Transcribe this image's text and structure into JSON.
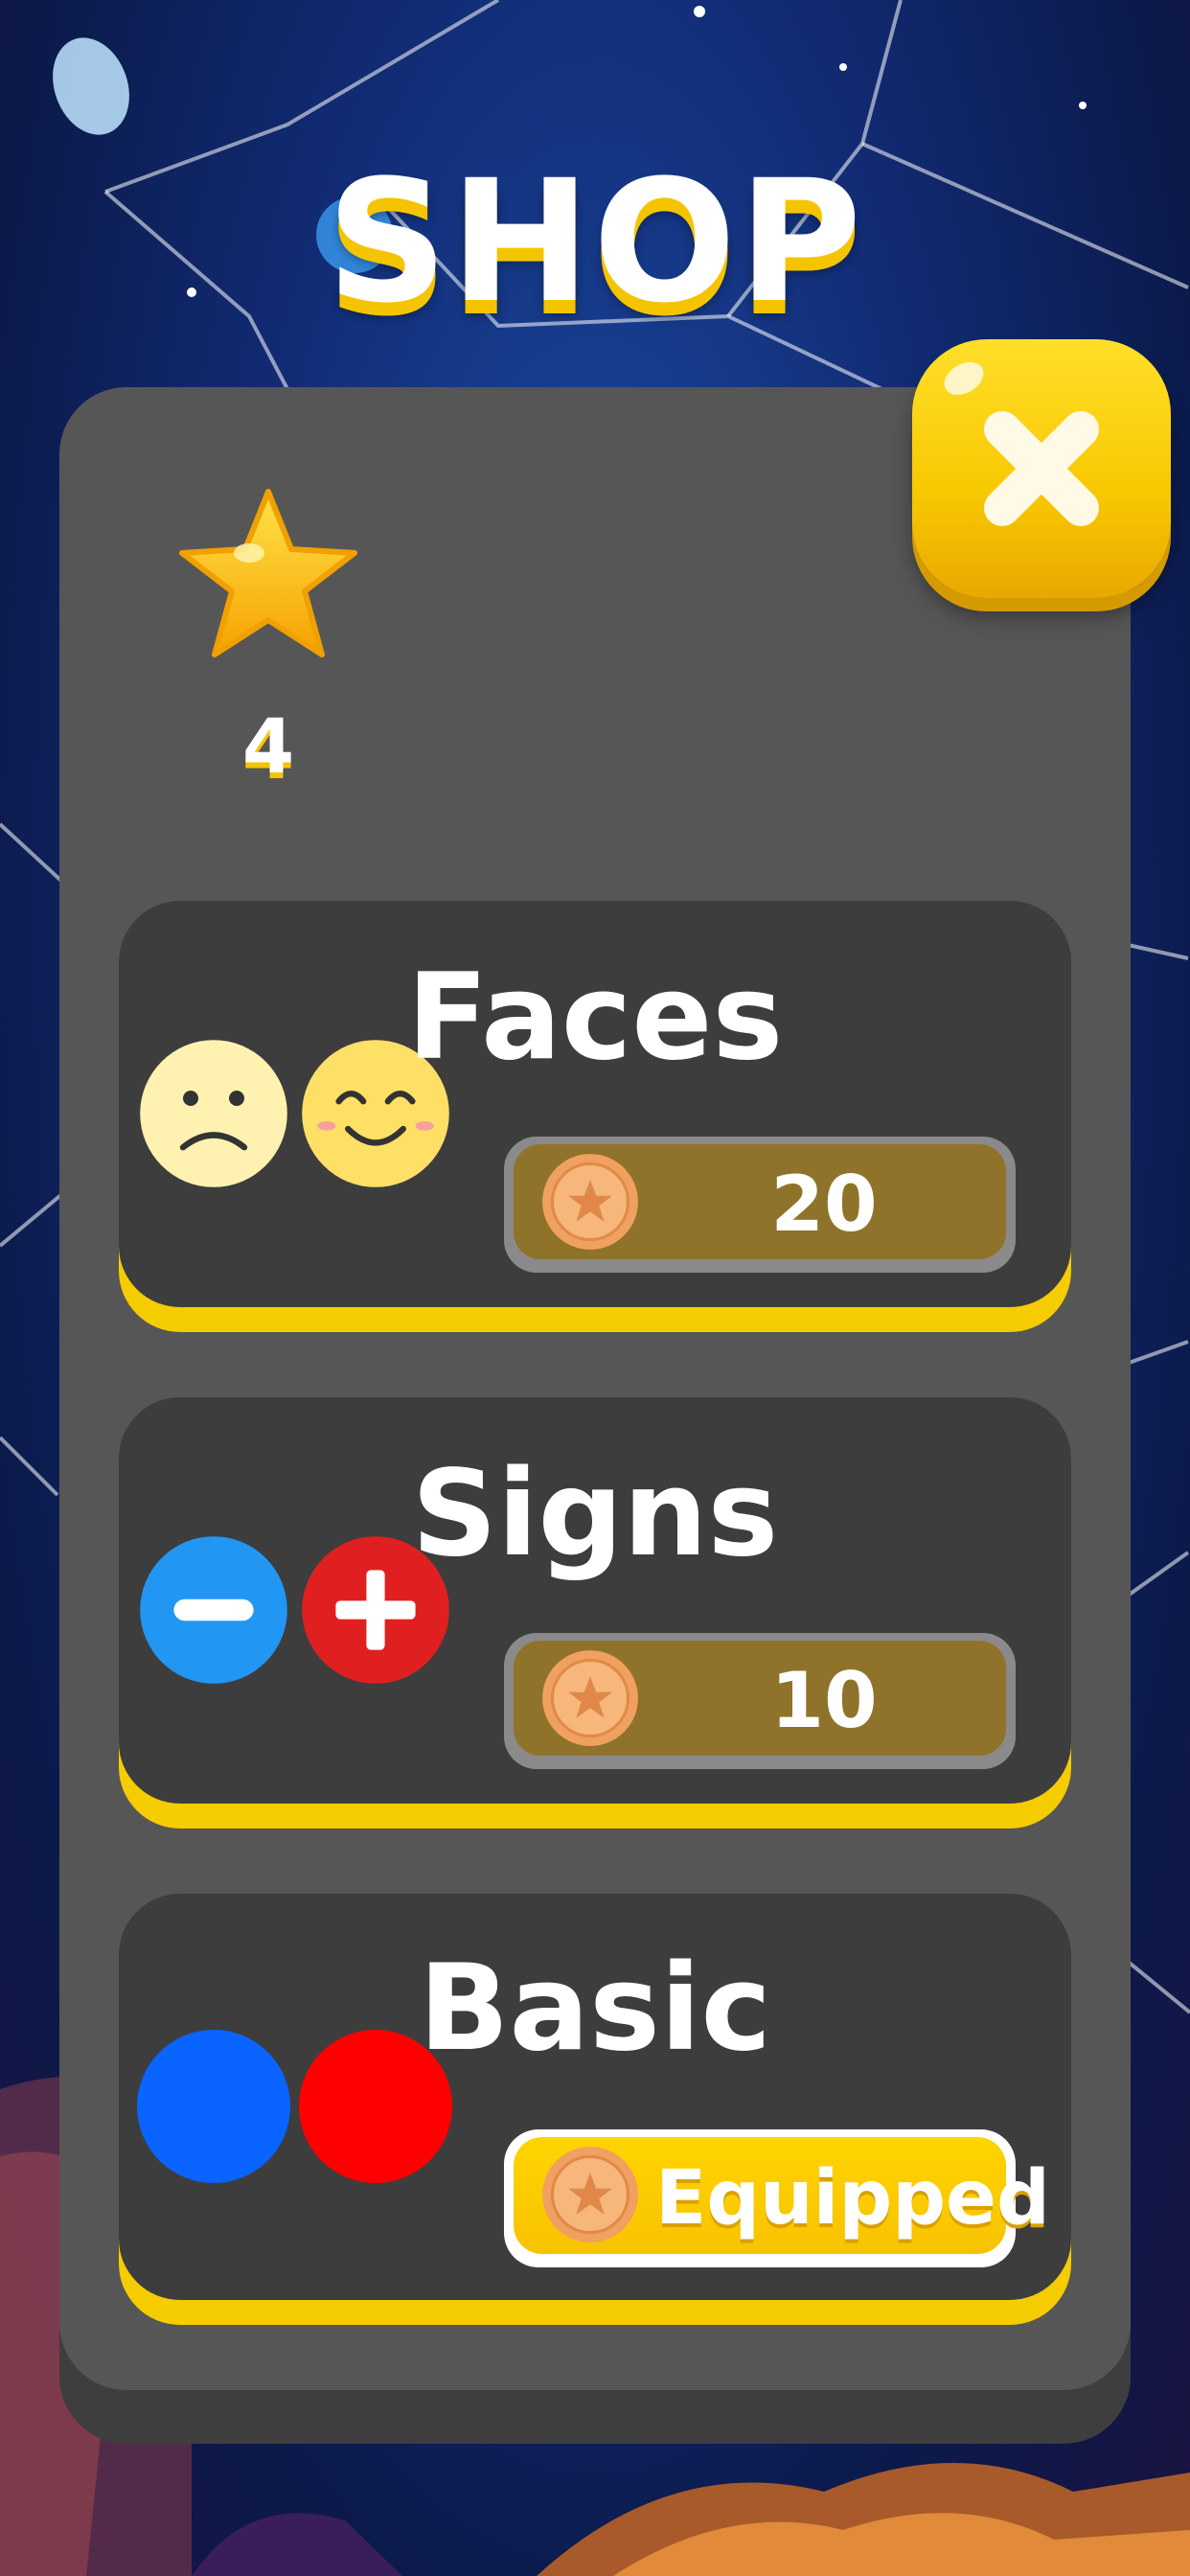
{
  "title": "SHOP",
  "stars": {
    "icon": "star-icon",
    "count": "4"
  },
  "close": {
    "icon": "close-icon"
  },
  "items": [
    {
      "name": "Faces",
      "icons": [
        "sad-face-icon",
        "smile-face-icon"
      ],
      "price": "20",
      "price_icon": "coin-icon"
    },
    {
      "name": "Signs",
      "icons": [
        "minus-circle-icon",
        "plus-circle-icon"
      ],
      "price": "10",
      "price_icon": "coin-icon"
    },
    {
      "name": "Basic",
      "icons": [
        "blue-circle-icon",
        "red-circle-icon"
      ],
      "status": "Equipped",
      "status_icon": "coin-icon"
    }
  ],
  "colors": {
    "accent_yellow": "#f5cc00",
    "panel": "#565656",
    "card": "#3d3d3d",
    "price_fill": "#8f732a",
    "sign_blue": "#2296f3",
    "sign_red": "#e02020",
    "basic_blue": "#0a64ff",
    "basic_red": "#ff0000"
  }
}
